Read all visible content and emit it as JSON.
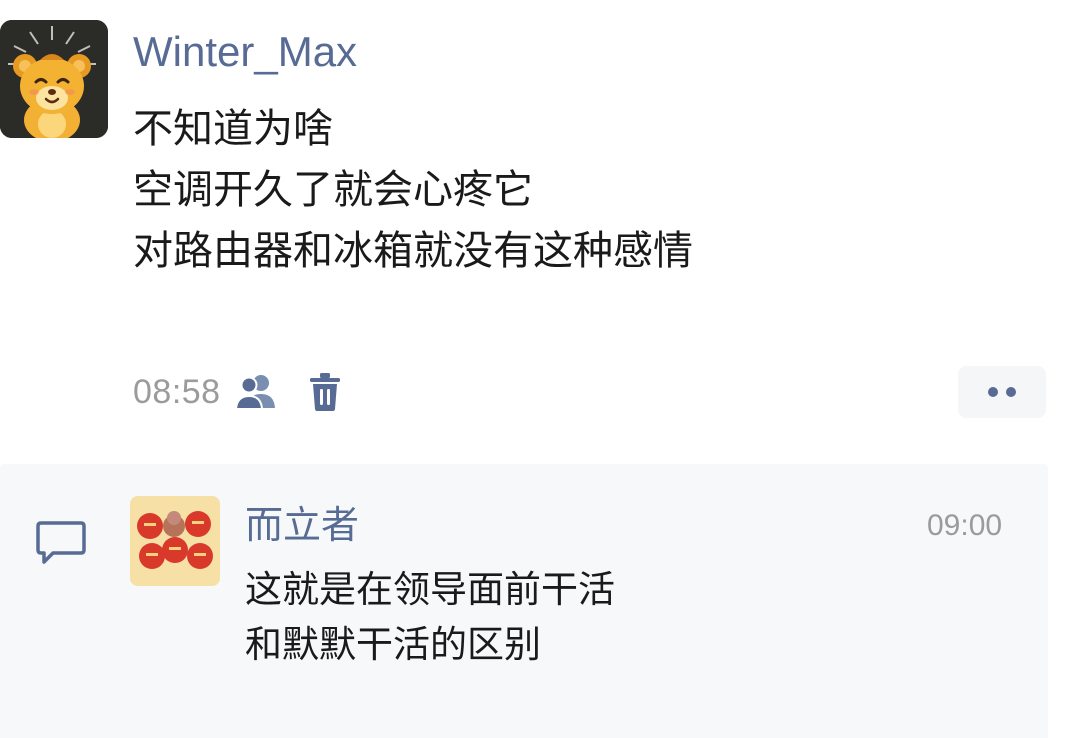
{
  "post": {
    "author": "Winter_Max",
    "lines": [
      "不知道为啥",
      "空调开久了就会心疼它",
      "对路由器和冰箱就没有这种感情"
    ],
    "time": "08:58",
    "icons": {
      "visibility": "friends-icon",
      "delete": "trash-icon",
      "more": "more-dots-icon"
    }
  },
  "comments": [
    {
      "author": "而立者",
      "time": "09:00",
      "lines": [
        "这就是在领导面前干活",
        "和默默干活的区别"
      ]
    }
  ],
  "comment_icon": "comment-bubble-icon",
  "colors": {
    "name_link": "#576b95",
    "meta_gray": "#9b9b9b",
    "comment_bg": "#f6f8f9"
  }
}
